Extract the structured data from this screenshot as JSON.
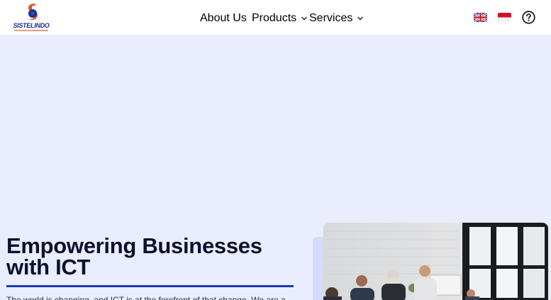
{
  "header": {
    "logo": {
      "wordmark": "SISTELINDO"
    },
    "nav": [
      {
        "label": "About Us",
        "has_dropdown": false
      },
      {
        "label": "Products",
        "has_dropdown": true
      },
      {
        "label": "Services",
        "has_dropdown": true
      }
    ],
    "languages": [
      {
        "code": "en",
        "icon": "uk-flag-icon"
      },
      {
        "code": "id",
        "icon": "indonesia-flag-icon"
      }
    ],
    "help_icon": "help-circle-icon"
  },
  "hero": {
    "title_line1": "Empowering Businesses",
    "title_line2": "with ICT",
    "body": "The world is changing, and ICT is at the forefront of that change. We are a",
    "accent_color": "#1a3bb0",
    "background_color": "#e9edfd"
  }
}
